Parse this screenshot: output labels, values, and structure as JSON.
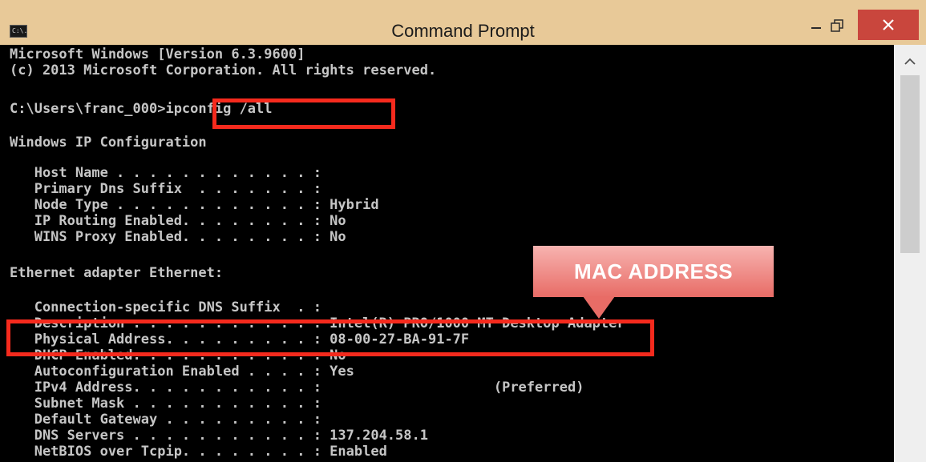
{
  "window": {
    "title": "Command Prompt",
    "icon_text": "C:\\."
  },
  "console": {
    "lines": [
      "Microsoft Windows [Version 6.3.9600]",
      "(c) 2013 Microsoft Corporation. All rights reserved.",
      "",
      "C:\\Users\\franc_000>ipconfig /all",
      "",
      "Windows IP Configuration",
      "",
      "   Host Name . . . . . . . . . . . . :",
      "   Primary Dns Suffix  . . . . . . . :",
      "   Node Type . . . . . . . . . . . . : Hybrid",
      "   IP Routing Enabled. . . . . . . . : No",
      "   WINS Proxy Enabled. . . . . . . . : No",
      "",
      "Ethernet adapter Ethernet:",
      "",
      "   Connection-specific DNS Suffix  . :",
      "   Description . . . . . . . . . . . : Intel(R) PRO/1000 MT Desktop Adapter",
      "   Physical Address. . . . . . . . . : 08-00-27-BA-91-7F",
      "   DHCP Enabled. . . . . . . . . . . : No",
      "   Autoconfiguration Enabled . . . . : Yes",
      "   IPv4 Address. . . . . . . . . . . :                     (Preferred)",
      "   Subnet Mask . . . . . . . . . . . :",
      "   Default Gateway . . . . . . . . . :",
      "   DNS Servers . . . . . . . . . . . : 137.204.58.1",
      "   NetBIOS over Tcpip. . . . . . . . : Enabled"
    ]
  },
  "annotation": {
    "callout_label": "MAC ADDRESS"
  },
  "colors": {
    "titlebar": "#e8c998",
    "console_bg": "#000000",
    "console_text": "#c6c6c6",
    "highlight": "#f52a1d",
    "close_button": "#c9463d"
  },
  "icons": {
    "minimize": "minimize-icon",
    "restore": "restore-icon",
    "close": "close-icon",
    "scroll_up": "scroll-up-arrow-icon"
  }
}
